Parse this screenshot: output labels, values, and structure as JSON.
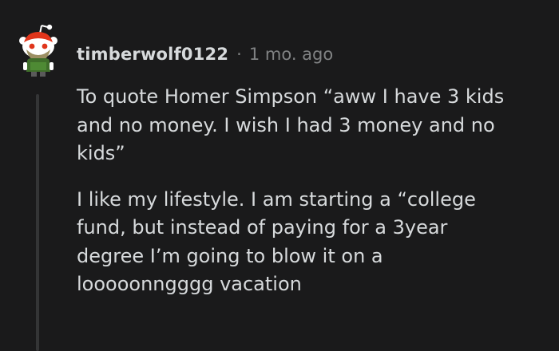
{
  "comment": {
    "author": "timberwolf0122",
    "separator": "·",
    "age": "1 mo. ago",
    "paragraphs": [
      [
        "To quote Homer Simpson “aww I have 3 kids",
        "and no money. I wish I had 3 money and no",
        "kids”"
      ],
      [
        "I like my lifestyle. I am starting a “college",
        "fund, but instead of paying for a 3year",
        "degree I’m going to blow it on a",
        "looooonngggg vacation"
      ]
    ]
  },
  "colors": {
    "background": "#1a1a1b",
    "text": "#d7dadc",
    "meta_text": "#818384",
    "thread_line": "#343536"
  },
  "icons": {
    "avatar": "snoo-avatar-icon"
  }
}
